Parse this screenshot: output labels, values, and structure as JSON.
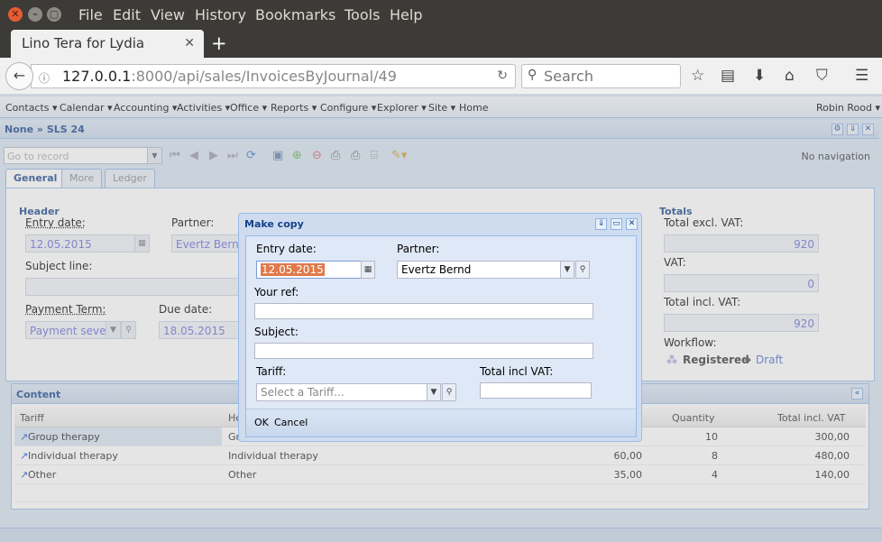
{
  "browser": {
    "menu": [
      "File",
      "Edit",
      "View",
      "History",
      "Bookmarks",
      "Tools",
      "Help"
    ],
    "tab_title": "Lino Tera for Lydia",
    "url_host": "127.0.0.1",
    "url_rest": ":8000/api/sales/InvoicesByJournal/49",
    "search_placeholder": "Search"
  },
  "app": {
    "menu": [
      "Contacts ▾",
      "Calendar ▾",
      "Accounting ▾",
      "Activities ▾",
      "Office ▾",
      "Reports ▾",
      "Configure ▾",
      "Explorer ▾",
      "Site ▾",
      "Home"
    ],
    "user": "Robin Rood ▾",
    "breadcrumb": "None » SLS 24",
    "goto_placeholder": "Go to record",
    "no_navigation": "No navigation",
    "tabs": [
      "General",
      "More",
      "Ledger"
    ],
    "header_section": "Header",
    "totals_section": "Totals",
    "entry_date_label": "Entry date:",
    "entry_date": "12.05.2015",
    "partner_label": "Partner:",
    "partner": "Evertz Bernd",
    "subject_label": "Subject line:",
    "payment_term_label": "Payment Term:",
    "payment_term": "Payment sever",
    "due_date_label": "Due date:",
    "due_date": "18.05.2015",
    "total_excl_label": "Total excl. VAT:",
    "total_excl": "920",
    "vat_label": "VAT:",
    "vat": "0",
    "total_incl_label": "Total incl. VAT:",
    "total_incl": "920",
    "workflow_label": "Workflow:",
    "workflow_state": "Registered",
    "workflow_arrow": "→",
    "workflow_action": "Draft"
  },
  "content": {
    "title": "Content",
    "columns": [
      "Tariff",
      "He",
      "Quantity",
      "Total incl. VAT"
    ],
    "rows": [
      {
        "tariff": "Group therapy",
        "description": "Gr",
        "price": "",
        "quantity": "10",
        "total": "300,00"
      },
      {
        "tariff": "Individual therapy",
        "description": "Individual therapy",
        "price": "60,00",
        "quantity": "8",
        "total": "480,00"
      },
      {
        "tariff": "Other",
        "description": "Other",
        "price": "35,00",
        "quantity": "4",
        "total": "140,00"
      }
    ]
  },
  "dialog": {
    "title": "Make copy",
    "entry_date_label": "Entry date:",
    "entry_date": "12.05.2015",
    "partner_label": "Partner:",
    "partner": "Evertz Bernd",
    "your_ref_label": "Your ref:",
    "subject_label": "Subject:",
    "tariff_label": "Tariff:",
    "tariff_placeholder": "Select a Tariff...",
    "total_incl_label": "Total incl VAT:",
    "ok": "OK",
    "cancel": "Cancel"
  }
}
